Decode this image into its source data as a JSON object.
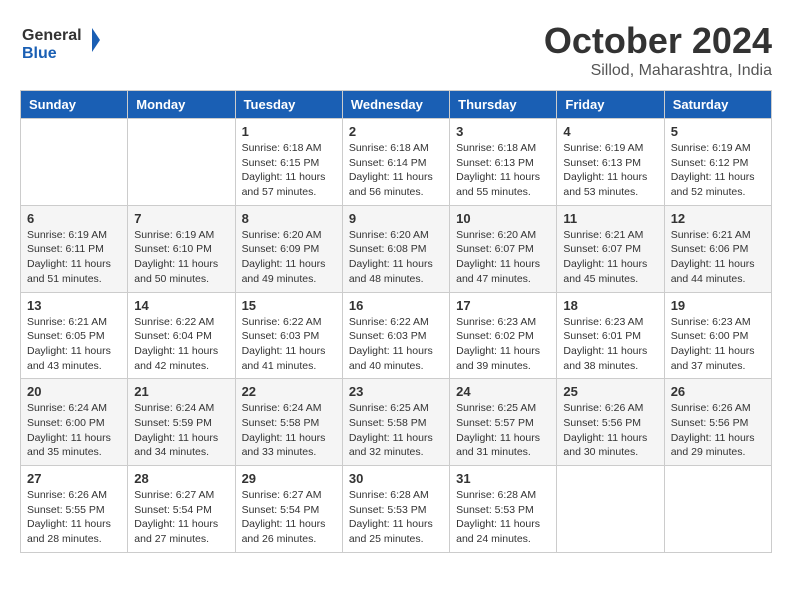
{
  "header": {
    "logo_line1": "General",
    "logo_line2": "Blue",
    "month": "October 2024",
    "location": "Sillod, Maharashtra, India"
  },
  "weekdays": [
    "Sunday",
    "Monday",
    "Tuesday",
    "Wednesday",
    "Thursday",
    "Friday",
    "Saturday"
  ],
  "weeks": [
    [
      {
        "day": "",
        "info": ""
      },
      {
        "day": "",
        "info": ""
      },
      {
        "day": "1",
        "info": "Sunrise: 6:18 AM\nSunset: 6:15 PM\nDaylight: 11 hours and 57 minutes."
      },
      {
        "day": "2",
        "info": "Sunrise: 6:18 AM\nSunset: 6:14 PM\nDaylight: 11 hours and 56 minutes."
      },
      {
        "day": "3",
        "info": "Sunrise: 6:18 AM\nSunset: 6:13 PM\nDaylight: 11 hours and 55 minutes."
      },
      {
        "day": "4",
        "info": "Sunrise: 6:19 AM\nSunset: 6:13 PM\nDaylight: 11 hours and 53 minutes."
      },
      {
        "day": "5",
        "info": "Sunrise: 6:19 AM\nSunset: 6:12 PM\nDaylight: 11 hours and 52 minutes."
      }
    ],
    [
      {
        "day": "6",
        "info": "Sunrise: 6:19 AM\nSunset: 6:11 PM\nDaylight: 11 hours and 51 minutes."
      },
      {
        "day": "7",
        "info": "Sunrise: 6:19 AM\nSunset: 6:10 PM\nDaylight: 11 hours and 50 minutes."
      },
      {
        "day": "8",
        "info": "Sunrise: 6:20 AM\nSunset: 6:09 PM\nDaylight: 11 hours and 49 minutes."
      },
      {
        "day": "9",
        "info": "Sunrise: 6:20 AM\nSunset: 6:08 PM\nDaylight: 11 hours and 48 minutes."
      },
      {
        "day": "10",
        "info": "Sunrise: 6:20 AM\nSunset: 6:07 PM\nDaylight: 11 hours and 47 minutes."
      },
      {
        "day": "11",
        "info": "Sunrise: 6:21 AM\nSunset: 6:07 PM\nDaylight: 11 hours and 45 minutes."
      },
      {
        "day": "12",
        "info": "Sunrise: 6:21 AM\nSunset: 6:06 PM\nDaylight: 11 hours and 44 minutes."
      }
    ],
    [
      {
        "day": "13",
        "info": "Sunrise: 6:21 AM\nSunset: 6:05 PM\nDaylight: 11 hours and 43 minutes."
      },
      {
        "day": "14",
        "info": "Sunrise: 6:22 AM\nSunset: 6:04 PM\nDaylight: 11 hours and 42 minutes."
      },
      {
        "day": "15",
        "info": "Sunrise: 6:22 AM\nSunset: 6:03 PM\nDaylight: 11 hours and 41 minutes."
      },
      {
        "day": "16",
        "info": "Sunrise: 6:22 AM\nSunset: 6:03 PM\nDaylight: 11 hours and 40 minutes."
      },
      {
        "day": "17",
        "info": "Sunrise: 6:23 AM\nSunset: 6:02 PM\nDaylight: 11 hours and 39 minutes."
      },
      {
        "day": "18",
        "info": "Sunrise: 6:23 AM\nSunset: 6:01 PM\nDaylight: 11 hours and 38 minutes."
      },
      {
        "day": "19",
        "info": "Sunrise: 6:23 AM\nSunset: 6:00 PM\nDaylight: 11 hours and 37 minutes."
      }
    ],
    [
      {
        "day": "20",
        "info": "Sunrise: 6:24 AM\nSunset: 6:00 PM\nDaylight: 11 hours and 35 minutes."
      },
      {
        "day": "21",
        "info": "Sunrise: 6:24 AM\nSunset: 5:59 PM\nDaylight: 11 hours and 34 minutes."
      },
      {
        "day": "22",
        "info": "Sunrise: 6:24 AM\nSunset: 5:58 PM\nDaylight: 11 hours and 33 minutes."
      },
      {
        "day": "23",
        "info": "Sunrise: 6:25 AM\nSunset: 5:58 PM\nDaylight: 11 hours and 32 minutes."
      },
      {
        "day": "24",
        "info": "Sunrise: 6:25 AM\nSunset: 5:57 PM\nDaylight: 11 hours and 31 minutes."
      },
      {
        "day": "25",
        "info": "Sunrise: 6:26 AM\nSunset: 5:56 PM\nDaylight: 11 hours and 30 minutes."
      },
      {
        "day": "26",
        "info": "Sunrise: 6:26 AM\nSunset: 5:56 PM\nDaylight: 11 hours and 29 minutes."
      }
    ],
    [
      {
        "day": "27",
        "info": "Sunrise: 6:26 AM\nSunset: 5:55 PM\nDaylight: 11 hours and 28 minutes."
      },
      {
        "day": "28",
        "info": "Sunrise: 6:27 AM\nSunset: 5:54 PM\nDaylight: 11 hours and 27 minutes."
      },
      {
        "day": "29",
        "info": "Sunrise: 6:27 AM\nSunset: 5:54 PM\nDaylight: 11 hours and 26 minutes."
      },
      {
        "day": "30",
        "info": "Sunrise: 6:28 AM\nSunset: 5:53 PM\nDaylight: 11 hours and 25 minutes."
      },
      {
        "day": "31",
        "info": "Sunrise: 6:28 AM\nSunset: 5:53 PM\nDaylight: 11 hours and 24 minutes."
      },
      {
        "day": "",
        "info": ""
      },
      {
        "day": "",
        "info": ""
      }
    ]
  ]
}
